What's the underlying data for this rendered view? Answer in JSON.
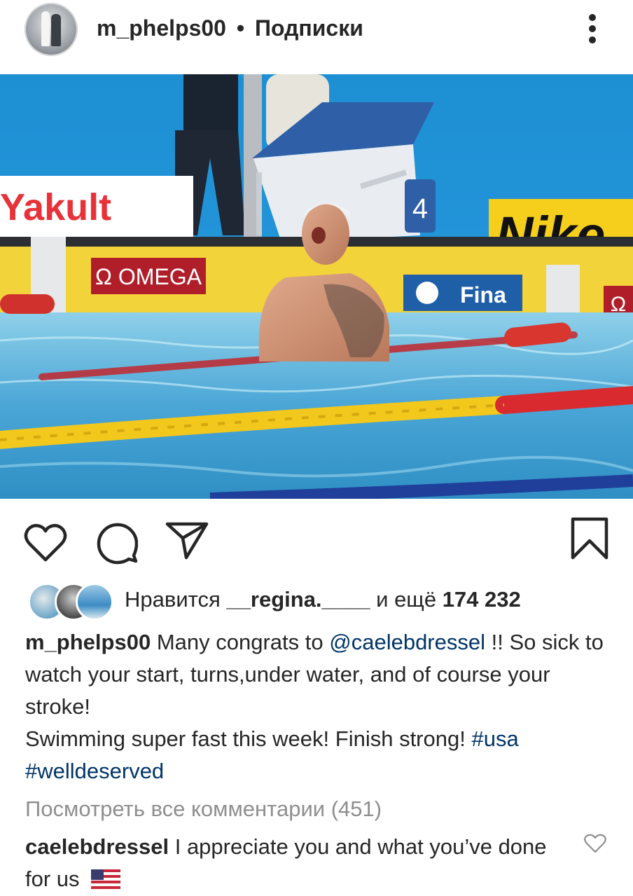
{
  "post": {
    "author": "m_phelps00",
    "separator": "•",
    "follow_status": "Подписки",
    "more_icon": "more-vertical-icon"
  },
  "photo": {
    "banner_left": "Yakult",
    "board_omega": "Ω OMEGA",
    "board_fina": "Fina",
    "banner_right": "Nike",
    "lane_number": "4",
    "omega_symbol": "Ω"
  },
  "actions": {
    "like_icon": "heart-outline-icon",
    "comment_icon": "comment-bubble-icon",
    "share_icon": "paper-plane-icon",
    "save_icon": "bookmark-icon"
  },
  "likes": {
    "prefix": "Нравится",
    "first_liker": "__regina.____",
    "middle": "и ещё",
    "count": "174 232"
  },
  "caption": {
    "user": "m_phelps00",
    "text1": "Many congrats to",
    "mention": "@caelebdressel",
    "text2": "!! So sick to watch your start, turns,under water, and of course your stroke!",
    "text3": "Swimming super fast this week!  Finish strong!",
    "hashtag1": "#usa",
    "hashtag2": "#welldeserved"
  },
  "comments": {
    "view_all": "Посмотреть все комментарии (451)",
    "top_comment_user": "caelebdressel",
    "top_comment_text": "I appreciate you and what you’ve done for us"
  },
  "colors": {
    "text": "#262626",
    "muted": "#8e8e8e",
    "link": "#003569",
    "pool": "#4aa6d6"
  }
}
